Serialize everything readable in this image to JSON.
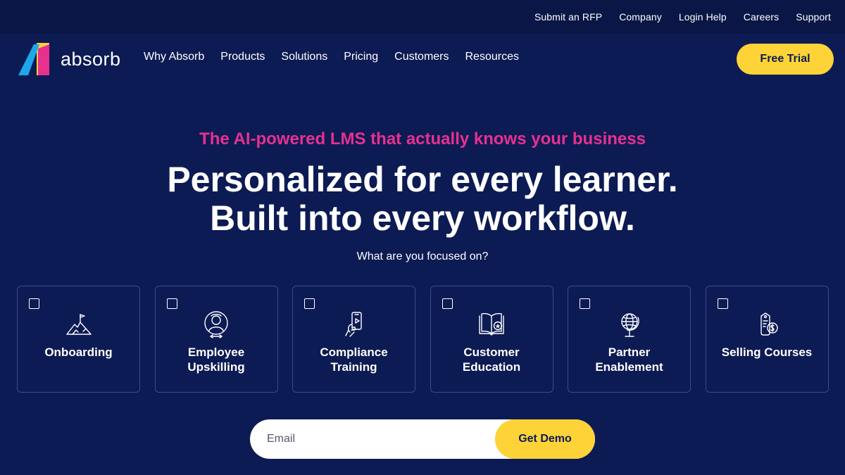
{
  "utility_nav": [
    "Submit an RFP",
    "Company",
    "Login Help",
    "Careers",
    "Support"
  ],
  "logo": {
    "text": "absorb",
    "colors": {
      "yellow": "#fdd337",
      "pink": "#e8308f",
      "blue": "#1ea7ea"
    }
  },
  "main_nav": [
    "Why Absorb",
    "Products",
    "Solutions",
    "Pricing",
    "Customers",
    "Resources"
  ],
  "free_trial_label": "Free Trial",
  "hero": {
    "kicker": "The AI-powered LMS that actually knows your business",
    "headline_line1": "Personalized for every learner.",
    "headline_line2": "Built into every workflow.",
    "question": "What are you focused on?"
  },
  "focus_cards": [
    {
      "label_line1": "Onboarding",
      "label_line2": "",
      "icon": "mountain-flag-icon",
      "checked": false
    },
    {
      "label_line1": "Employee",
      "label_line2": "Upskilling",
      "icon": "person-growth-icon",
      "checked": false
    },
    {
      "label_line1": "Compliance",
      "label_line2": "Training",
      "icon": "mobile-hand-icon",
      "checked": false
    },
    {
      "label_line1": "Customer",
      "label_line2": "Education",
      "icon": "book-badge-icon",
      "checked": false
    },
    {
      "label_line1": "Partner",
      "label_line2": "Enablement",
      "icon": "globe-icon",
      "checked": false
    },
    {
      "label_line1": "Selling Courses",
      "label_line2": "",
      "icon": "price-tag-icon",
      "checked": false
    }
  ],
  "email_form": {
    "placeholder": "Email",
    "value": "",
    "button_label": "Get Demo"
  },
  "colors": {
    "background": "#0d1b54",
    "utility_bar": "#0a1645",
    "accent_yellow": "#fdd337",
    "accent_pink": "#e8308f"
  }
}
